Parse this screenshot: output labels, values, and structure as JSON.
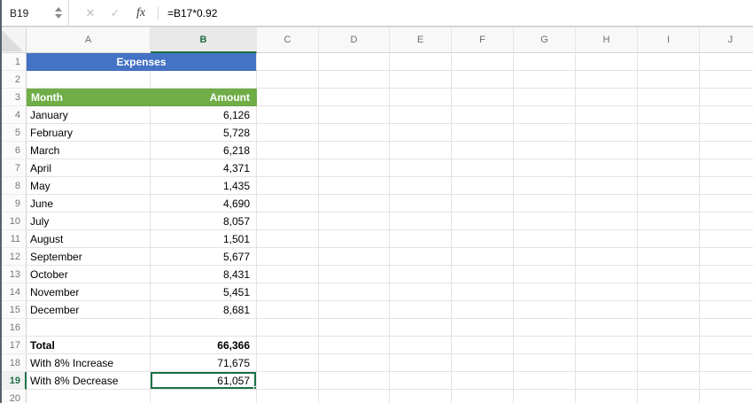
{
  "app_type": "spreadsheet",
  "colors": {
    "title_fill": "#4472c4",
    "table_header_fill": "#70ad47",
    "selection_green": "#1e7145"
  },
  "formula_bar": {
    "cell_reference": "B19",
    "cancel_glyph": "✕",
    "enter_glyph": "✓",
    "fx_glyph": "fx",
    "formula": "=B17*0.92"
  },
  "grid": {
    "column_headers": [
      "A",
      "B",
      "C",
      "D",
      "E",
      "F",
      "G",
      "H",
      "I",
      "J"
    ],
    "selected_column": "B",
    "selected_row": 19,
    "selected_cell": "B19",
    "rows": [
      {
        "n": 1,
        "type": "title",
        "a": "Expenses",
        "b": ""
      },
      {
        "n": 2,
        "type": "empty",
        "a": "",
        "b": ""
      },
      {
        "n": 3,
        "type": "header",
        "a": "Month",
        "b": "Amount"
      },
      {
        "n": 4,
        "type": "data",
        "a": "January",
        "b": "6,126"
      },
      {
        "n": 5,
        "type": "data",
        "a": "February",
        "b": "5,728"
      },
      {
        "n": 6,
        "type": "data",
        "a": "March",
        "b": "6,218"
      },
      {
        "n": 7,
        "type": "data",
        "a": "April",
        "b": "4,371"
      },
      {
        "n": 8,
        "type": "data",
        "a": "May",
        "b": "1,435"
      },
      {
        "n": 9,
        "type": "data",
        "a": "June",
        "b": "4,690"
      },
      {
        "n": 10,
        "type": "data",
        "a": "July",
        "b": "8,057"
      },
      {
        "n": 11,
        "type": "data",
        "a": "August",
        "b": "1,501"
      },
      {
        "n": 12,
        "type": "data",
        "a": "September",
        "b": "5,677"
      },
      {
        "n": 13,
        "type": "data",
        "a": "October",
        "b": "8,431"
      },
      {
        "n": 14,
        "type": "data",
        "a": "November",
        "b": "5,451"
      },
      {
        "n": 15,
        "type": "data",
        "a": "December",
        "b": "8,681"
      },
      {
        "n": 16,
        "type": "empty",
        "a": "",
        "b": ""
      },
      {
        "n": 17,
        "type": "data",
        "bold": true,
        "a": "Total",
        "b": "66,366"
      },
      {
        "n": 18,
        "type": "data",
        "a": "With 8% Increase",
        "b": "71,675"
      },
      {
        "n": 19,
        "type": "data",
        "a": "With 8% Decrease",
        "b": "61,057",
        "selected": true
      },
      {
        "n": 20,
        "type": "empty",
        "a": "",
        "b": ""
      }
    ]
  }
}
